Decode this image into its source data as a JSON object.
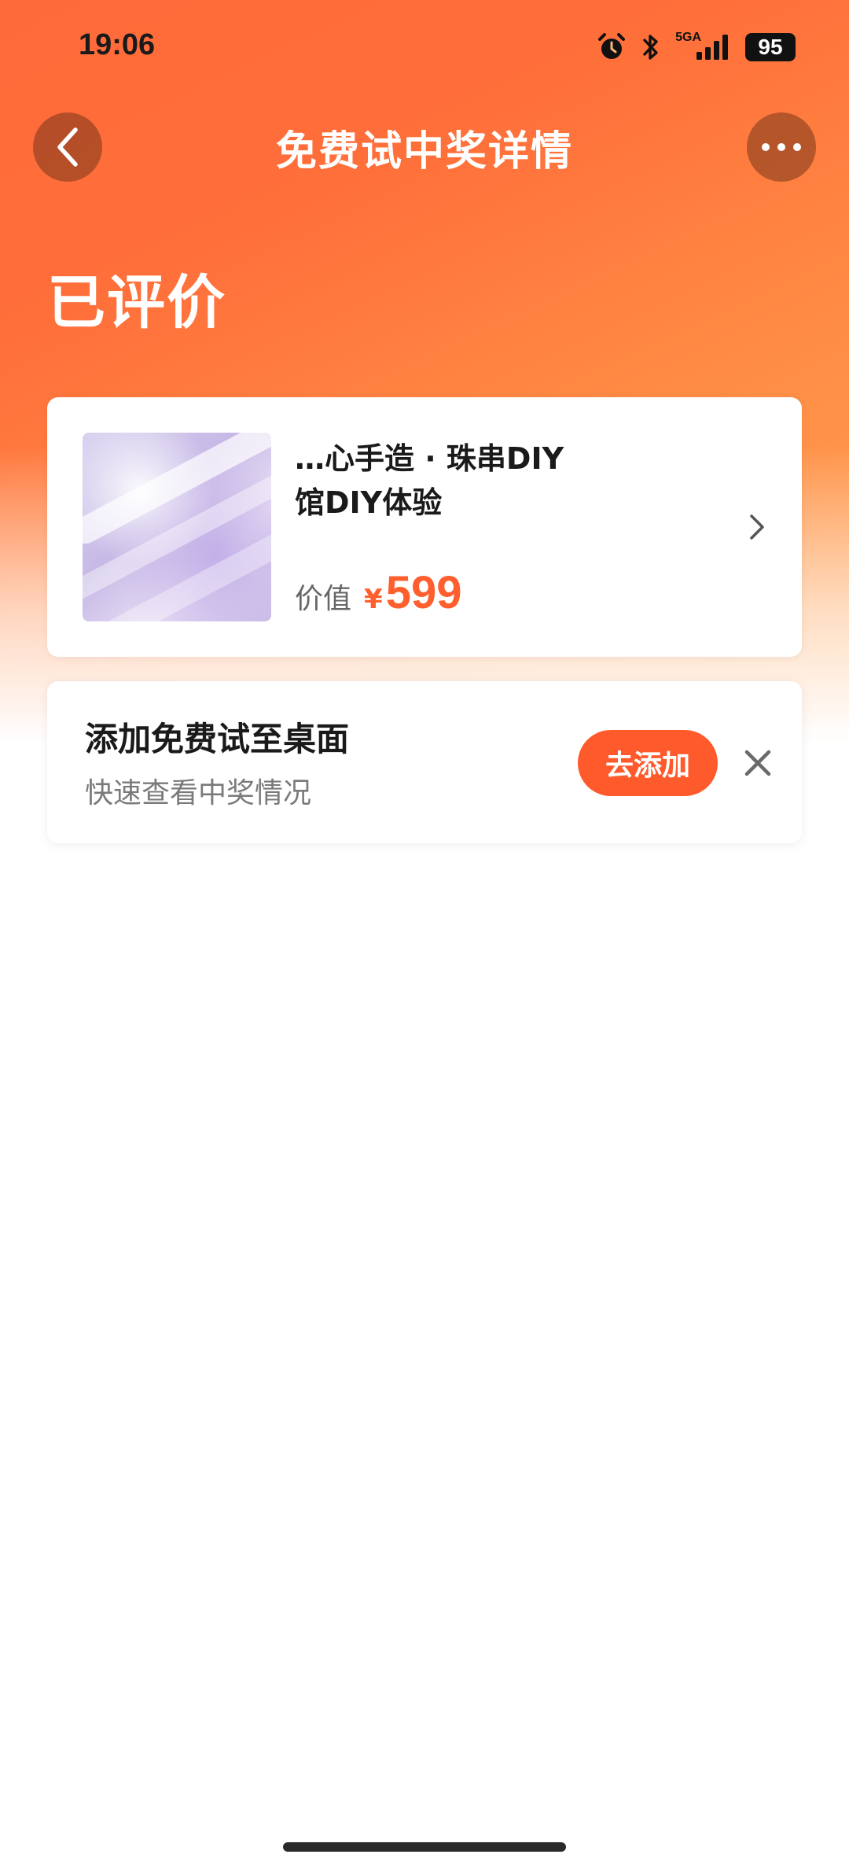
{
  "status_bar": {
    "time": "19:06",
    "network": "5GA",
    "battery": "95",
    "icons": [
      "alarm-icon",
      "bluetooth-icon",
      "signal-icon",
      "battery-icon"
    ]
  },
  "nav": {
    "title": "免费试中奖详情",
    "back_icon": "chevron-left-icon",
    "more_icon": "more-dots-icon"
  },
  "status_heading": "已评价",
  "product": {
    "title": "…珠串DIY馆DIY体验",
    "title_line1": "  …心手造 · 珠串DIY",
    "title_line2": "馆DIY体验",
    "price_label": "价值",
    "currency": "¥",
    "price": "599"
  },
  "widget_tip": {
    "title": "添加免费试至桌面",
    "subtitle": "快速查看中奖情况",
    "button": "去添加"
  },
  "colors": {
    "accent": "#ff5f2e",
    "hero_start": "#ff6a3a",
    "hero_end": "#ffa552",
    "nav_button_bg": "#8a3f1d"
  }
}
